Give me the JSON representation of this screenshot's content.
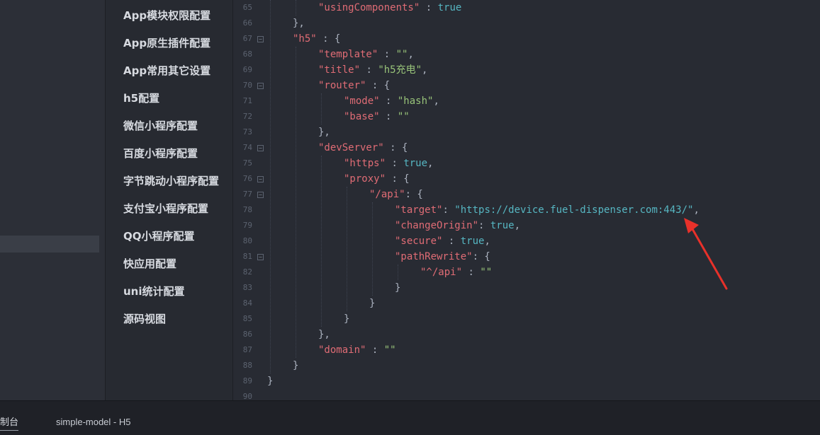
{
  "config_nav": {
    "items": [
      "App模块权限配置",
      "App原生插件配置",
      "App常用其它设置",
      "h5配置",
      "微信小程序配置",
      "百度小程序配置",
      "字节跳动小程序配置",
      "支付宝小程序配置",
      "QQ小程序配置",
      "快应用配置",
      "uni统计配置",
      "源码视图"
    ]
  },
  "editor": {
    "line_numbers": [
      "65",
      "66",
      "67",
      "68",
      "69",
      "70",
      "71",
      "72",
      "73",
      "74",
      "75",
      "76",
      "77",
      "78",
      "79",
      "80",
      "81",
      "82",
      "83",
      "84",
      "85",
      "86",
      "87",
      "88",
      "89",
      "90"
    ],
    "lines": [
      {
        "tokens": [
          [
            "\"usingComponents\"",
            "key"
          ],
          [
            " : ",
            "p"
          ],
          [
            "true",
            "kw"
          ]
        ]
      },
      {
        "tokens": [
          [
            "},",
            "p"
          ]
        ]
      },
      {
        "tokens": [
          [
            "\"h5\"",
            "key"
          ],
          [
            " : {",
            "p"
          ]
        ]
      },
      {
        "tokens": [
          [
            "\"template\"",
            "key"
          ],
          [
            " : ",
            "p"
          ],
          [
            "\"\"",
            "str"
          ],
          [
            ",",
            "p"
          ]
        ]
      },
      {
        "tokens": [
          [
            "\"title\"",
            "key"
          ],
          [
            " : ",
            "p"
          ],
          [
            "\"h5充电\"",
            "str"
          ],
          [
            ",",
            "p"
          ]
        ]
      },
      {
        "tokens": [
          [
            "\"router\"",
            "key"
          ],
          [
            " : {",
            "p"
          ]
        ]
      },
      {
        "tokens": [
          [
            "\"mode\"",
            "key"
          ],
          [
            " : ",
            "p"
          ],
          [
            "\"hash\"",
            "str"
          ],
          [
            ",",
            "p"
          ]
        ]
      },
      {
        "tokens": [
          [
            "\"base\"",
            "key"
          ],
          [
            " : ",
            "p"
          ],
          [
            "\"\"",
            "str"
          ]
        ]
      },
      {
        "tokens": [
          [
            "},",
            "p"
          ]
        ]
      },
      {
        "tokens": [
          [
            "\"devServer\"",
            "key"
          ],
          [
            " : {",
            "p"
          ]
        ]
      },
      {
        "tokens": [
          [
            "\"https\"",
            "key"
          ],
          [
            " : ",
            "p"
          ],
          [
            "true",
            "kw"
          ],
          [
            ",",
            "p"
          ]
        ]
      },
      {
        "tokens": [
          [
            "\"proxy\"",
            "key"
          ],
          [
            " : {",
            "p"
          ]
        ]
      },
      {
        "tokens": [
          [
            "\"/api\"",
            "key"
          ],
          [
            ": {",
            "p"
          ]
        ]
      },
      {
        "tokens": [
          [
            "\"target\"",
            "key"
          ],
          [
            ": ",
            "p"
          ],
          [
            "\"https://device.fuel-dispenser.com:443/\"",
            "url"
          ],
          [
            ",",
            "p"
          ]
        ]
      },
      {
        "tokens": [
          [
            "\"changeOrigin\"",
            "key"
          ],
          [
            ": ",
            "p"
          ],
          [
            "true",
            "kw"
          ],
          [
            ",",
            "p"
          ]
        ]
      },
      {
        "tokens": [
          [
            "\"secure\"",
            "key"
          ],
          [
            " : ",
            "p"
          ],
          [
            "true",
            "kw"
          ],
          [
            ",",
            "p"
          ]
        ]
      },
      {
        "tokens": [
          [
            "\"pathRewrite\"",
            "key"
          ],
          [
            ": {",
            "p"
          ]
        ]
      },
      {
        "tokens": [
          [
            "\"^/api\"",
            "key"
          ],
          [
            " : ",
            "p"
          ],
          [
            "\"\"",
            "str"
          ]
        ]
      },
      {
        "tokens": [
          [
            "}",
            "p"
          ]
        ]
      },
      {
        "tokens": [
          [
            "}",
            "p"
          ]
        ]
      },
      {
        "tokens": [
          [
            "}",
            "p"
          ]
        ]
      },
      {
        "tokens": [
          [
            "},",
            "p"
          ]
        ]
      },
      {
        "tokens": [
          [
            "\"domain\"",
            "key"
          ],
          [
            " : ",
            "p"
          ],
          [
            "\"\"",
            "str"
          ]
        ]
      },
      {
        "tokens": [
          [
            "}",
            "p"
          ]
        ]
      },
      {
        "tokens": [
          [
            "}",
            "p"
          ]
        ]
      },
      {
        "tokens": []
      }
    ]
  },
  "bottom_bar": {
    "console_tab": "制台",
    "project_tab": "simple-model - H5"
  },
  "annotation": {
    "arrow_color": "#e8312a"
  },
  "colors": {
    "key": "#e06c75",
    "string": "#98c379",
    "keyword": "#56b6c2",
    "punctuation": "#abb2bf"
  }
}
